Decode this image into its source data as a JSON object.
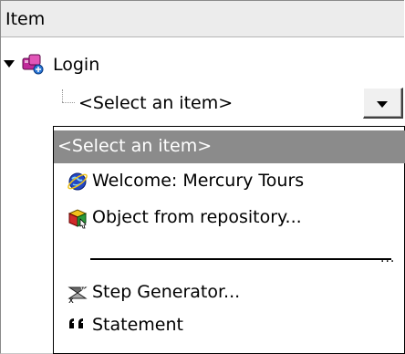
{
  "header": {
    "column_title": "Item"
  },
  "tree": {
    "root_label": "Login",
    "root_icon": "action-icon",
    "child_combo_value": "<Select an item>"
  },
  "dropdown": {
    "items": [
      {
        "label": "<Select an item>",
        "icon": "",
        "selected": true
      },
      {
        "label": "Welcome: Mercury Tours",
        "icon": "browser-globe-icon"
      },
      {
        "label": "Object from repository...",
        "icon": "object-repository-icon"
      },
      {
        "label": "Step Generator...",
        "icon": "step-generator-icon"
      },
      {
        "label": "Statement",
        "icon": "statement-icon"
      }
    ],
    "separator_dots": "...",
    "selected_bg": "#8b8b8b"
  }
}
